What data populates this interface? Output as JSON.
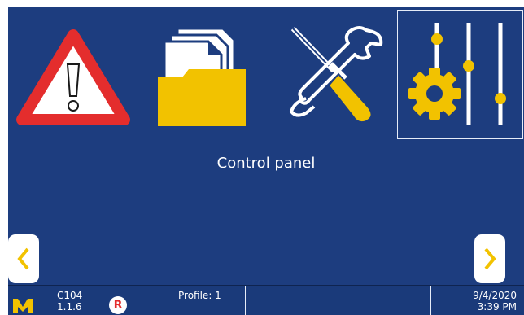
{
  "menu": {
    "items": [
      {
        "name": "alarms",
        "icon": "warning-triangle-icon"
      },
      {
        "name": "files",
        "icon": "folder-documents-icon"
      },
      {
        "name": "tools",
        "icon": "screwdriver-wrench-icon"
      },
      {
        "name": "control-panel",
        "icon": "gear-sliders-icon",
        "selected": true
      }
    ],
    "caption": "Control panel"
  },
  "nav": {
    "prev_icon": "chevron-left-icon",
    "next_icon": "chevron-right-icon"
  },
  "status_bar": {
    "logo": "M",
    "device_id": "C104",
    "version": "1.1.6",
    "remote_badge": "R",
    "profile": "Profile: 1",
    "date": "9/4/2020",
    "time": "3:39 PM"
  },
  "colors": {
    "background": "#1d3d7f",
    "accent": "#f2c200",
    "alert_red": "#e42d2d",
    "icon_white": "#ffffff"
  }
}
